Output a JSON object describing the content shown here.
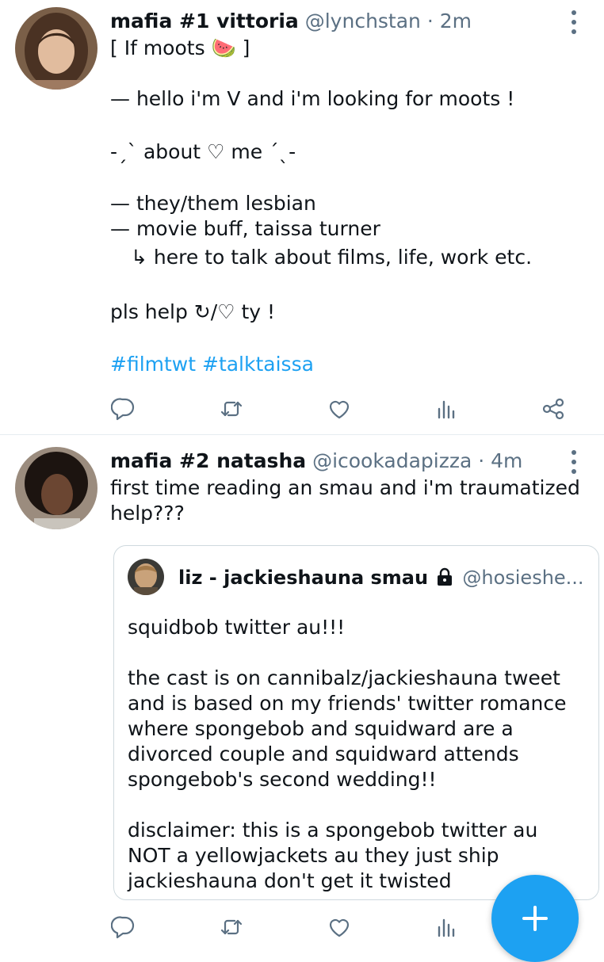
{
  "colors": {
    "accent": "#1da1f2",
    "secondary_text": "#5b7083",
    "primary_text": "#0f1419",
    "divider": "#e6ecf0"
  },
  "tweets": [
    {
      "display_name": "mafia #1 vittoria",
      "handle": "@lynchstan",
      "separator": "·",
      "time": "2m",
      "lines": [
        "[ If moots 🍉 ]",
        "— hello i'm V and i'm looking for moots !",
        "-ˏˋ about ♡ me ˊˎ-",
        "— they/them lesbian",
        "— movie buff, taissa turner",
        "↳ here to talk about films, life, work etc.",
        "pls help ↻/♡ ty !"
      ],
      "hashtags": "#filmtwt #talktaissa",
      "actions": [
        "reply-icon",
        "retweet-icon",
        "like-icon",
        "analytics-icon",
        "share-icon"
      ]
    },
    {
      "display_name": "mafia #2 natasha",
      "handle": "@icookadapizza",
      "separator": "·",
      "time": "4m",
      "lines": [
        "first time reading an smau and i'm traumatized",
        "help???"
      ],
      "quote": {
        "display_name": "liz - jackieshauna smau",
        "handle": "@hosieshe...",
        "lines": [
          "squidbob twitter au!!!",
          "the cast is on cannibalz/jackieshauna tweet",
          "and is based on my friends' twitter romance",
          "where spongebob and squidward are a",
          "divorced couple and squidward attends",
          "spongebob's second wedding!!",
          "disclaimer: this is a spongebob twitter au",
          "NOT a yellowjackets au they just ship",
          "jackieshauna don't get it twisted"
        ]
      },
      "actions": [
        "reply-icon",
        "retweet-icon",
        "like-icon",
        "analytics-icon"
      ]
    }
  ],
  "fab": {
    "icon": "compose-plus-icon"
  }
}
